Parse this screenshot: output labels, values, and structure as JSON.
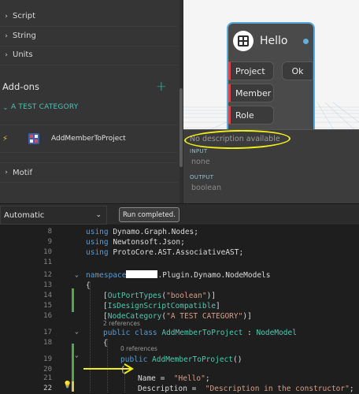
{
  "library": {
    "categories": [
      {
        "label": "Script"
      },
      {
        "label": "String"
      },
      {
        "label": "Units"
      }
    ],
    "addons_header": "Add-ons",
    "addons_add_icon": "plus-icon",
    "test_category": "A TEST CATEGORY",
    "node_item_label": "AddMemberToProject",
    "motif_label": "Motif"
  },
  "node": {
    "title": "Hello",
    "inputs": [
      "Project",
      "Member",
      "Role"
    ],
    "output": "Ok"
  },
  "tooltip": {
    "description": "No description available",
    "input_label": "INPUT",
    "input_value": "none",
    "output_label": "OUTPUT",
    "output_value": "boolean"
  },
  "statusbar": {
    "run_mode": "Automatic",
    "run_status": "Run completed."
  },
  "code": {
    "lines": [
      {
        "num": "8",
        "parts": [
          [
            "kw",
            "using"
          ],
          [
            "",
            "Dynamo.Graph.Nodes;"
          ]
        ]
      },
      {
        "num": "9",
        "parts": [
          [
            "kw",
            "using"
          ],
          [
            "",
            "Newtonsoft.Json;"
          ]
        ]
      },
      {
        "num": "10",
        "parts": [
          [
            "kw",
            "using"
          ],
          [
            "",
            "ProtoCore.AST.AssociativeAST;"
          ]
        ]
      },
      {
        "num": "11",
        "parts": []
      },
      {
        "num": "12",
        "parts": [
          [
            "kw",
            "namespace"
          ],
          [
            "redact",
            ""
          ],
          [
            "",
            ".Plugin.Dynamo.NodeModels"
          ]
        ]
      },
      {
        "num": "13",
        "parts": [
          [
            "",
            "{"
          ]
        ]
      },
      {
        "num": "14",
        "parts": [
          [
            "",
            "["
          ],
          [
            "ty",
            "OutPortTypes"
          ],
          [
            "",
            "("
          ],
          [
            "st",
            "\"boolean\""
          ],
          [
            "",
            ")]"
          ]
        ]
      },
      {
        "num": "15",
        "parts": [
          [
            "",
            "["
          ],
          [
            "ty",
            "IsDesignScriptCompatible"
          ],
          [
            "",
            "]"
          ]
        ]
      },
      {
        "num": "16",
        "parts": [
          [
            "",
            "["
          ],
          [
            "ty",
            "NodeCategory"
          ],
          [
            "",
            "("
          ],
          [
            "st",
            "\"A TEST CATEGORY\""
          ],
          [
            "",
            ")]"
          ]
        ]
      },
      {
        "num": "17",
        "parts": [
          [
            "kw",
            "public class"
          ],
          [
            "ty",
            "AddMemberToProject"
          ],
          [
            "",
            ":"
          ],
          [
            "ty",
            "NodeModel"
          ]
        ]
      },
      {
        "num": "18",
        "parts": [
          [
            "",
            "{"
          ]
        ]
      },
      {
        "num": "19",
        "parts": [
          [
            "kw",
            "public"
          ],
          [
            "ty",
            "AddMemberToProject"
          ],
          [
            "",
            "()"
          ]
        ]
      },
      {
        "num": "20",
        "parts": [
          [
            "",
            "{"
          ]
        ]
      },
      {
        "num": "21",
        "parts": [
          [
            "",
            "Name = "
          ],
          [
            "st",
            "\"Hello\""
          ],
          [
            "",
            ";"
          ]
        ]
      },
      {
        "num": "22",
        "parts": [
          [
            "",
            "Description = "
          ],
          [
            "st",
            "\"Description in the constructor\""
          ],
          [
            "",
            ";"
          ]
        ]
      }
    ],
    "refs_1": "2 references",
    "refs_2": "0 references"
  }
}
